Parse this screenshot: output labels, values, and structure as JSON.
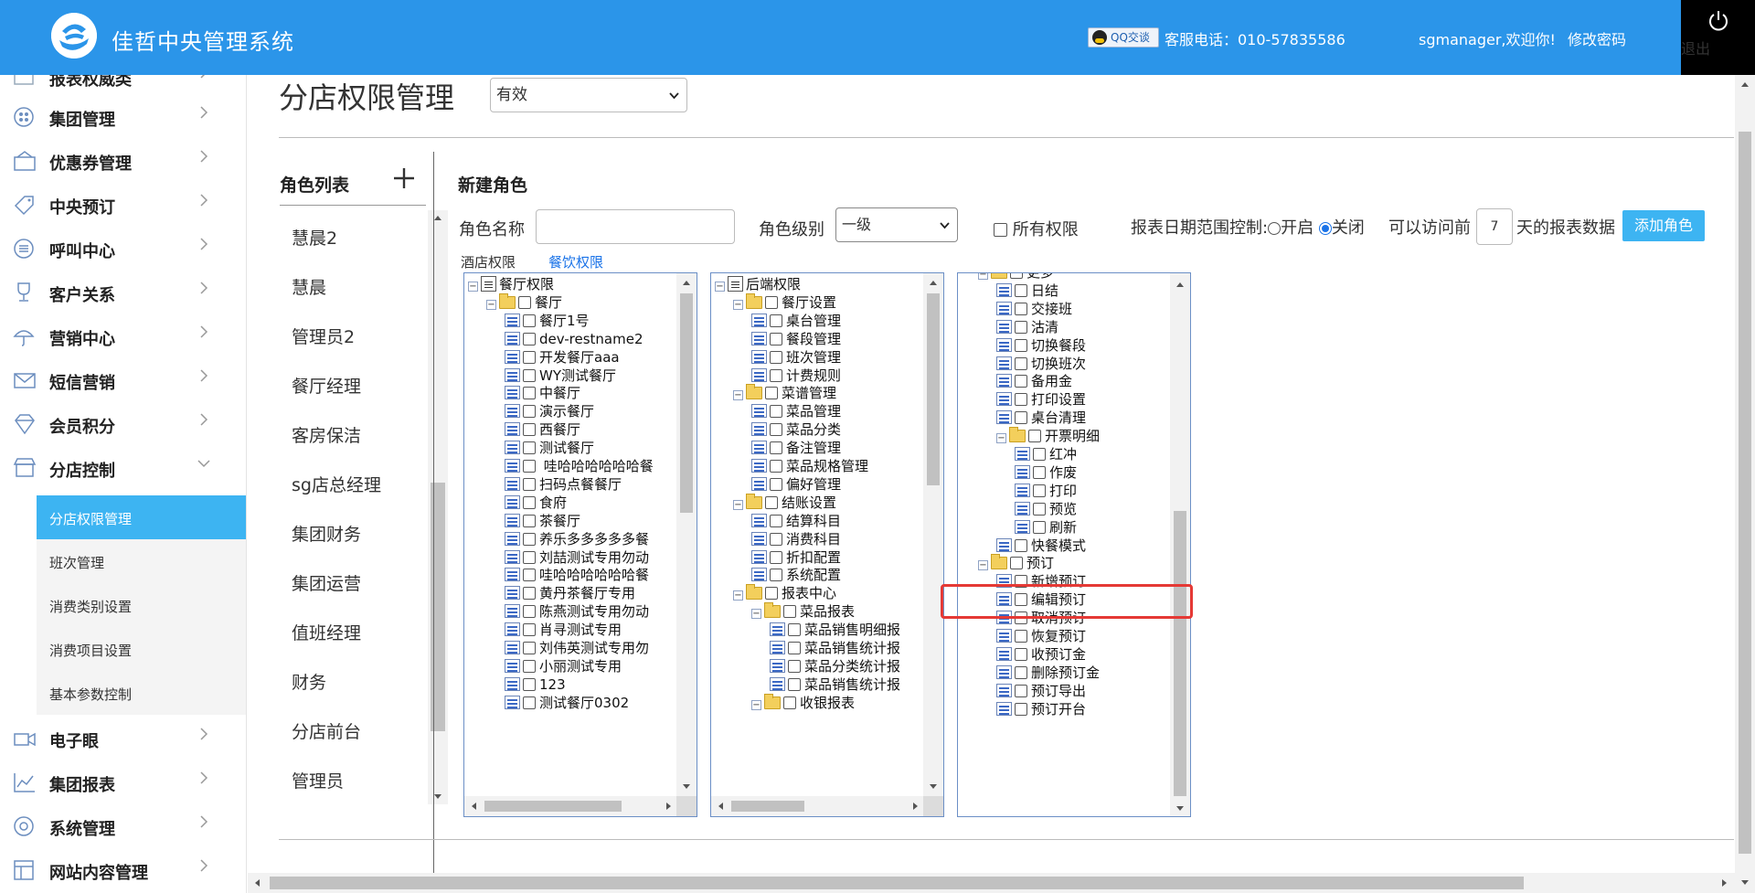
{
  "header": {
    "app_title": "佳哲中央管理系统",
    "qq_badge": "QQ交谈",
    "hotline": "客服电话：010-57835586",
    "welcome": "sgmanager,欢迎你!",
    "change_password": "修改密码",
    "logout": "退出"
  },
  "sidebar": {
    "items": [
      {
        "label": "报表权威类",
        "icon": "report-icon"
      },
      {
        "label": "集团管理",
        "icon": "group-icon"
      },
      {
        "label": "优惠券管理",
        "icon": "coupon-icon"
      },
      {
        "label": "中央预订",
        "icon": "tag-icon"
      },
      {
        "label": "呼叫中心",
        "icon": "list-icon"
      },
      {
        "label": "客户关系",
        "icon": "trophy-icon"
      },
      {
        "label": "营销中心",
        "icon": "umbrella-icon"
      },
      {
        "label": "短信营销",
        "icon": "mail-icon"
      },
      {
        "label": "会员积分",
        "icon": "diamond-icon"
      },
      {
        "label": "分店控制",
        "icon": "store-icon"
      }
    ],
    "sub_items": [
      {
        "label": "分店权限管理",
        "active": true
      },
      {
        "label": "班次管理"
      },
      {
        "label": "消费类别设置"
      },
      {
        "label": "消费项目设置"
      },
      {
        "label": "基本参数控制"
      }
    ],
    "items_after": [
      {
        "label": "电子眼",
        "icon": "camera-icon"
      },
      {
        "label": "集团报表",
        "icon": "chart-icon"
      },
      {
        "label": "系统管理",
        "icon": "settings-icon"
      },
      {
        "label": "网站内容管理",
        "icon": "grid-icon"
      }
    ]
  },
  "page": {
    "title": "分店权限管理",
    "status_select": "有效"
  },
  "role_list": {
    "title": "角色列表",
    "roles": [
      "慧晨2",
      "慧晨",
      "管理员2",
      "餐厅经理",
      "客房保洁",
      "sg店总经理",
      "集团财务",
      "集团运营",
      "值班经理",
      "财务",
      "分店前台",
      "管理员"
    ]
  },
  "new_role": {
    "title": "新建角色",
    "name_label": "角色名称",
    "name_value": "",
    "level_label": "角色级别",
    "level_value": "一级",
    "all_perms_label": "所有权限",
    "date_range_label": "报表日期范围控制:",
    "radio_on_label": "开启",
    "radio_off_label": "关闭",
    "access_prefix": "可以访问前",
    "days_value": "7",
    "access_suffix": "天的报表数据",
    "add_button": "添加角色",
    "tab_hotel": "酒店权限",
    "tab_dining": "餐饮权限"
  },
  "tree1": [
    {
      "label": "餐厅权限",
      "kind": "root",
      "depth": 0
    },
    {
      "label": "餐厅",
      "kind": "folder",
      "depth": 1
    },
    {
      "label": "餐厅1号",
      "kind": "doc",
      "depth": 2
    },
    {
      "label": "dev-restname2",
      "kind": "doc",
      "depth": 2
    },
    {
      "label": "开发餐厅aaa",
      "kind": "doc",
      "depth": 2
    },
    {
      "label": "WY测试餐厅",
      "kind": "doc",
      "depth": 2
    },
    {
      "label": "中餐厅",
      "kind": "doc",
      "depth": 2
    },
    {
      "label": "演示餐厅",
      "kind": "doc",
      "depth": 2
    },
    {
      "label": "西餐厅",
      "kind": "doc",
      "depth": 2
    },
    {
      "label": "测试餐厅",
      "kind": "doc",
      "depth": 2
    },
    {
      "label": " 哇哈哈哈哈哈哈餐",
      "kind": "doc",
      "depth": 2
    },
    {
      "label": "扫码点餐餐厅",
      "kind": "doc",
      "depth": 2
    },
    {
      "label": "食府",
      "kind": "doc",
      "depth": 2
    },
    {
      "label": "茶餐厅",
      "kind": "doc",
      "depth": 2
    },
    {
      "label": "养乐多多多多多餐",
      "kind": "doc",
      "depth": 2
    },
    {
      "label": "刘喆测试专用勿动",
      "kind": "doc",
      "depth": 2
    },
    {
      "label": "哇哈哈哈哈哈哈餐",
      "kind": "doc",
      "depth": 2
    },
    {
      "label": "黄丹茶餐厅专用",
      "kind": "doc",
      "depth": 2
    },
    {
      "label": "陈燕测试专用勿动",
      "kind": "doc",
      "depth": 2
    },
    {
      "label": "肖寻测试专用",
      "kind": "doc",
      "depth": 2
    },
    {
      "label": "刘伟英测试专用勿",
      "kind": "doc",
      "depth": 2
    },
    {
      "label": "小丽测试专用",
      "kind": "doc",
      "depth": 2
    },
    {
      "label": "123",
      "kind": "doc",
      "depth": 2
    },
    {
      "label": "测试餐厅0302",
      "kind": "doc",
      "depth": 2
    }
  ],
  "tree2": [
    {
      "label": "后端权限",
      "kind": "root",
      "depth": 0
    },
    {
      "label": "餐厅设置",
      "kind": "folder",
      "depth": 1
    },
    {
      "label": "桌台管理",
      "kind": "doc",
      "depth": 2
    },
    {
      "label": "餐段管理",
      "kind": "doc",
      "depth": 2
    },
    {
      "label": "班次管理",
      "kind": "doc",
      "depth": 2
    },
    {
      "label": "计费规则",
      "kind": "doc",
      "depth": 2
    },
    {
      "label": "菜谱管理",
      "kind": "folder",
      "depth": 1
    },
    {
      "label": "菜品管理",
      "kind": "doc",
      "depth": 2
    },
    {
      "label": "菜品分类",
      "kind": "doc",
      "depth": 2
    },
    {
      "label": "备注管理",
      "kind": "doc",
      "depth": 2
    },
    {
      "label": "菜品规格管理",
      "kind": "doc",
      "depth": 2
    },
    {
      "label": "偏好管理",
      "kind": "doc",
      "depth": 2
    },
    {
      "label": "结账设置",
      "kind": "folder",
      "depth": 1
    },
    {
      "label": "结算科目",
      "kind": "doc",
      "depth": 2
    },
    {
      "label": "消费科目",
      "kind": "doc",
      "depth": 2
    },
    {
      "label": "折扣配置",
      "kind": "doc",
      "depth": 2
    },
    {
      "label": "系统配置",
      "kind": "doc",
      "depth": 2
    },
    {
      "label": "报表中心",
      "kind": "folder",
      "depth": 1
    },
    {
      "label": "菜品报表",
      "kind": "folder",
      "depth": 2
    },
    {
      "label": "菜品销售明细报",
      "kind": "doc",
      "depth": 3
    },
    {
      "label": "菜品销售统计报",
      "kind": "doc",
      "depth": 3
    },
    {
      "label": "菜品分类统计报",
      "kind": "doc",
      "depth": 3
    },
    {
      "label": "菜品销售统计报",
      "kind": "doc",
      "depth": 3
    },
    {
      "label": "收银报表",
      "kind": "folder",
      "depth": 2
    }
  ],
  "tree3": [
    {
      "label": "更多",
      "kind": "folder",
      "depth": 1
    },
    {
      "label": "日结",
      "kind": "doc",
      "depth": 2
    },
    {
      "label": "交接班",
      "kind": "doc",
      "depth": 2
    },
    {
      "label": "沽清",
      "kind": "doc",
      "depth": 2
    },
    {
      "label": "切换餐段",
      "kind": "doc",
      "depth": 2
    },
    {
      "label": "切换班次",
      "kind": "doc",
      "depth": 2
    },
    {
      "label": "备用金",
      "kind": "doc",
      "depth": 2
    },
    {
      "label": "打印设置",
      "kind": "doc",
      "depth": 2
    },
    {
      "label": "桌台清理",
      "kind": "doc",
      "depth": 2
    },
    {
      "label": "开票明细",
      "kind": "folder",
      "depth": 2
    },
    {
      "label": "红冲",
      "kind": "doc",
      "depth": 3
    },
    {
      "label": "作废",
      "kind": "doc",
      "depth": 3
    },
    {
      "label": "打印",
      "kind": "doc",
      "depth": 3
    },
    {
      "label": "预览",
      "kind": "doc",
      "depth": 3
    },
    {
      "label": "刷新",
      "kind": "doc",
      "depth": 3
    },
    {
      "label": "快餐模式",
      "kind": "doc",
      "depth": 2
    },
    {
      "label": "预订",
      "kind": "folder",
      "depth": 1
    },
    {
      "label": "新增预订",
      "kind": "doc",
      "depth": 2
    },
    {
      "label": "编辑预订",
      "kind": "doc",
      "depth": 2
    },
    {
      "label": "取消预订",
      "kind": "doc",
      "depth": 2
    },
    {
      "label": "恢复预订",
      "kind": "doc",
      "depth": 2
    },
    {
      "label": "收预订金",
      "kind": "doc",
      "depth": 2
    },
    {
      "label": "删除预订金",
      "kind": "doc",
      "depth": 2
    },
    {
      "label": "预订导出",
      "kind": "doc",
      "depth": 2
    },
    {
      "label": "预订开台",
      "kind": "doc",
      "depth": 2
    }
  ]
}
